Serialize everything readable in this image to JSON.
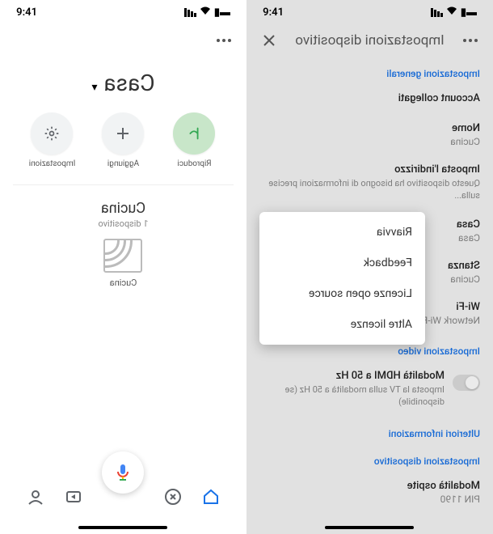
{
  "status": {
    "time": "9:41"
  },
  "left": {
    "header_title": "Impostazioni dispositivo",
    "sections": {
      "general": "Impostazioni generali",
      "linked_accounts": {
        "label": "Account collegati"
      },
      "name": {
        "label": "Nome",
        "value": "Cucina"
      },
      "address": {
        "label": "Imposta l'indirizzo",
        "desc": "Questo dispositivo ha bisogno di informazioni precise sulla..."
      },
      "home": {
        "label": "Casa",
        "value": "Casa"
      },
      "room": {
        "label": "Stanza",
        "value": "Cucina"
      },
      "wifi": {
        "label": "Wi-Fi",
        "value": "Network Wi-Fi d"
      },
      "video": "Impostazioni video",
      "hdmi": {
        "label": "Modalità HDMI a 50 Hz",
        "desc": "Imposta la TV sulla modalità a 50 Hz (se disponibile)"
      },
      "more_info": "Ulteriori informazioni",
      "device": "Impostazioni dispositivo",
      "guest": {
        "label": "Modalità ospite",
        "value": "PIN 1190"
      }
    },
    "menu": {
      "restart": "Riavvia",
      "feedback": "Feedback",
      "oss_licenses": "Licenze open source",
      "other_licenses": "Altre licenze"
    }
  },
  "right": {
    "home_title": "Casa",
    "actions": {
      "play": "Riproduci",
      "add": "Aggiungi",
      "settings": "Impostazioni"
    },
    "room": {
      "name": "Cucina",
      "sub": "1 dispositivo",
      "device_label": "Cucina"
    }
  }
}
